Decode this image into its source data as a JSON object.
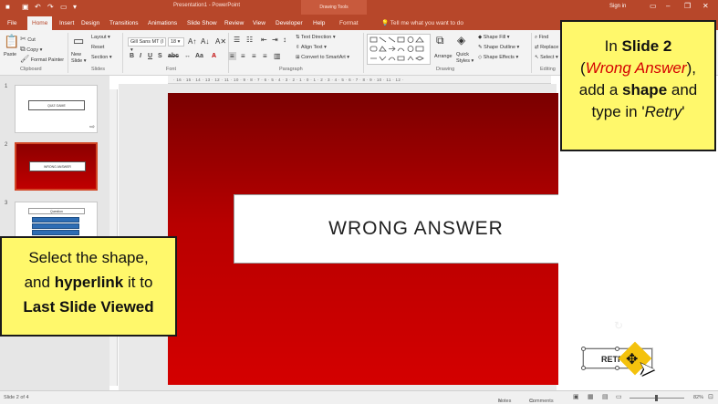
{
  "window": {
    "title": "Presentation1 - PowerPoint",
    "context_tab_group": "Drawing Tools",
    "sign_in": "Sign in",
    "controls": [
      "–",
      "❐",
      "✕"
    ]
  },
  "tabs": [
    {
      "label": "File"
    },
    {
      "label": "Home",
      "active": true
    },
    {
      "label": "Insert"
    },
    {
      "label": "Design"
    },
    {
      "label": "Transitions"
    },
    {
      "label": "Animations"
    },
    {
      "label": "Slide Show"
    },
    {
      "label": "Review"
    },
    {
      "label": "View"
    },
    {
      "label": "Developer"
    },
    {
      "label": "Help"
    },
    {
      "label": "Format"
    }
  ],
  "tell_me": "Tell me what you want to do",
  "ribbon": {
    "clipboard": {
      "paste": "Paste",
      "cut": "Cut",
      "copy": "Copy ▾",
      "format_painter": "Format Painter",
      "group": "Clipboard"
    },
    "slides": {
      "new_slide": "New Slide ▾",
      "layout": "Layout ▾",
      "reset": "Reset",
      "section": "Section ▾",
      "group": "Slides"
    },
    "font": {
      "name": "Gill Sans MT (I ▾",
      "size": "18 ▾",
      "group": "Font"
    },
    "paragraph": {
      "text_direction": "Text Direction ▾",
      "align_text": "Align Text ▾",
      "smartart": "Convert to SmartArt ▾",
      "group": "Paragraph"
    },
    "drawing": {
      "arrange": "Arrange",
      "quick_styles": "Quick Styles ▾",
      "shape_fill": "Shape Fill ▾",
      "shape_outline": "Shape Outline ▾",
      "shape_effects": "Shape Effects ▾",
      "group": "Drawing"
    },
    "editing": {
      "find": "Find",
      "replace": "Replace ▾",
      "select": "Select ▾",
      "group": "Editing"
    }
  },
  "ruler_text": "· 16 · 15 · 14 · 13 · 12 · 11 · 10 · 9 · 8 · 7 · 6 · 5 · 4 · 3 · 2 · 1 · 0 · 1 · 2 · 3 · 4 · 5 · 6 · 7 · 8 · 9 · 10 · 11 · 12 ·",
  "thumbnails": [
    {
      "number": "1",
      "text": "QUIZ GAME"
    },
    {
      "number": "2",
      "text": "WRONG ANSWER",
      "selected": true
    },
    {
      "number": "3",
      "text": "Question"
    }
  ],
  "slide": {
    "main_text": "WRONG ANSWER",
    "retry_text": "RETRY"
  },
  "callouts": {
    "top": {
      "l1_pre": "In ",
      "l1_bold": "Slide 2",
      "l2_open": "(",
      "l2_red": "Wrong Answer",
      "l2_close": "),",
      "l3_pre": "add a ",
      "l3_bold": "shape",
      "l3_post": " and",
      "l4_pre": "type in '",
      "l4_italic": "Retry",
      "l4_post": "'"
    },
    "left": {
      "l1": "Select the shape,",
      "l2_pre": "and ",
      "l2_bold": "hyperlink",
      "l2_post": " it to",
      "l3_bold": "Last Slide Viewed"
    }
  },
  "status": {
    "slide_info": "Slide 2 of 4",
    "notes": "Notes",
    "comments": "Comments",
    "zoom": "82%"
  }
}
